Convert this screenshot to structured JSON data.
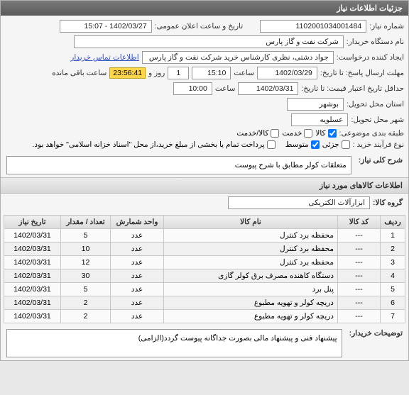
{
  "panel": {
    "title": "جزئیات اطلاعات نیاز"
  },
  "info": {
    "need_no_label": "شماره نیاز:",
    "need_no": "1102001034001484",
    "announce_label": "تاریخ و ساعت اعلان عمومی:",
    "announce_val": "1402/03/27 - 15:07",
    "buyer_org_label": "نام دستگاه خریدار:",
    "buyer_org": "شرکت نفت و گاز پارس",
    "requester_label": "ایجاد کننده درخواست:",
    "requester": "جواد دشتی، نظری کارشناس خرید  شرکت نفت و گاز پارس",
    "contact_link": "اطلاعات تماس خریدار",
    "deadline_from_label": "مهلت ارسال پاسخ: تا تاریخ:",
    "deadline_date": "1402/03/29",
    "time_label": "ساعت",
    "deadline_time": "15:10",
    "day_label": "روز و",
    "days": "1",
    "remaining_suffix": "ساعت باقی مانده",
    "remaining_time": "23:56:41",
    "valid_until_label": "حداقل تاریخ اعتبار قیمت: تا تاریخ:",
    "valid_date": "1402/03/31",
    "valid_time": "10:00",
    "province_label": "استان محل تحویل:",
    "province": "بوشهر",
    "city_label": "شهر محل تحویل:",
    "city": "عسلویه",
    "category_label": "طبقه بندی موضوعی:",
    "chk_kala": "کالا",
    "chk_service": "خدمت",
    "chk_both": "کالا/خدمت",
    "process_label": "نوع فرآیند خرید :",
    "chk_partial": "جزئی",
    "chk_medium": "متوسط",
    "payment_note": "پرداخت تمام یا بخشی از مبلغ خرید،از محل \"اسناد خزانه اسلامی\" خواهد بود."
  },
  "desc": {
    "label": "شرح کلی نیاز:",
    "text": "متعلقات کولر مطابق با شرح پیوست"
  },
  "goods": {
    "title": "اطلاعات کالاهای مورد نیاز",
    "group_label": "گروه کالا:",
    "group": "ابزارآلات الکتریکی"
  },
  "table": {
    "headers": {
      "row": "ردیف",
      "code": "کد کالا",
      "name": "نام کالا",
      "unit": "واحد شمارش",
      "qty": "تعداد / مقدار",
      "date": "تاریخ نیاز"
    },
    "rows": [
      {
        "n": "1",
        "code": "---",
        "name": "محفظه برد کنترل",
        "unit": "عدد",
        "qty": "5",
        "date": "1402/03/31"
      },
      {
        "n": "2",
        "code": "---",
        "name": "محفظه برد کنترل",
        "unit": "عدد",
        "qty": "10",
        "date": "1402/03/31"
      },
      {
        "n": "3",
        "code": "---",
        "name": "محفظه برد کنترل",
        "unit": "عدد",
        "qty": "12",
        "date": "1402/03/31"
      },
      {
        "n": "4",
        "code": "---",
        "name": "دستگاه کاهنده مصرف برق کولر گازی",
        "unit": "عدد",
        "qty": "30",
        "date": "1402/03/31"
      },
      {
        "n": "5",
        "code": "---",
        "name": "پنل برد",
        "unit": "عدد",
        "qty": "5",
        "date": "1402/03/31"
      },
      {
        "n": "6",
        "code": "---",
        "name": "دریچه کولر و تهویه مطبوع",
        "unit": "عدد",
        "qty": "2",
        "date": "1402/03/31"
      },
      {
        "n": "7",
        "code": "---",
        "name": "دریچه کولر و تهویه مطبوع",
        "unit": "عدد",
        "qty": "2",
        "date": "1402/03/31"
      }
    ]
  },
  "buyer_notes": {
    "label": "توضیحات خریدار:",
    "text": "پیشنهاد فنی و پیشنهاد مالی بصورت جداگانه پیوست گردد(الزامی)"
  }
}
